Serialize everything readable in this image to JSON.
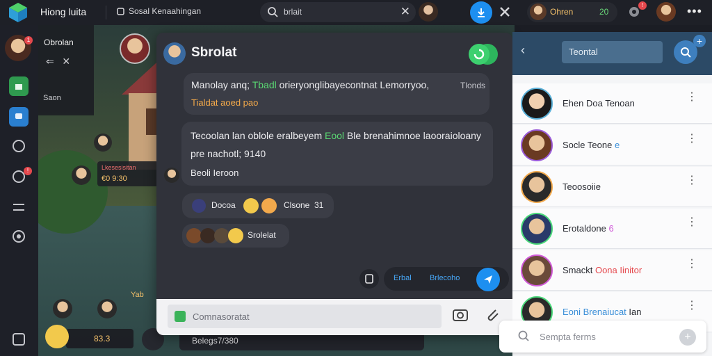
{
  "app": {
    "name": "Hiong luita",
    "workspace": "Sosal Kenaahingan"
  },
  "search": {
    "value": "brlait"
  },
  "user": {
    "name": "Ohren",
    "count": "20"
  },
  "friend_panel": {
    "name": "Obrolan",
    "status": "Saon"
  },
  "scene": {
    "tag_title": "Lkesesisitan",
    "tag_value": "€0 9:30",
    "bottom_tag": "83.3",
    "coord": "Belegs7/380",
    "note": "Yab"
  },
  "chat": {
    "title": "Sbrolat",
    "messages": [
      {
        "parts": [
          "Manolay anq; ",
          "Tbadl",
          " orieryonglibayecontnat Lemorryoo, "
        ],
        "meta": "Tlonds",
        "line2": "Tialdat aoed pao"
      },
      {
        "line1a": "Tecoolan lan oblole eralbeyem ",
        "line1b": "Eool",
        "line1c": " Ble brenahimnoe laooraioloany",
        "line2": "pre nachotl; 9140",
        "line3": "Beoli Ieroon"
      },
      {
        "left": "Docoa",
        "right": "Clsone",
        "num": "31"
      },
      {
        "text": "Srolelat"
      }
    ],
    "chip_left": "Erbal",
    "chip_right": "Brlecoho",
    "composer_placeholder": "Comnasoratat"
  },
  "right_panel": {
    "field": "Teontal",
    "contacts": [
      {
        "name": "Ehen Doa Tenoan"
      },
      {
        "name": "Socle Teone",
        "accent": "e"
      },
      {
        "name": "Teoosoiie"
      },
      {
        "name": "Erotaldone",
        "accent": "6"
      },
      {
        "name": "Smackt",
        "accent": "Oona Iinitor"
      },
      {
        "name": "Eoni Brenaiucat",
        "accent": "Ian"
      }
    ],
    "search_placeholder": "Sempta ferms"
  },
  "colors": {
    "accent": "#1d8ff0",
    "green": "#5ad873",
    "orange": "#f3a94a",
    "header_blue": "#2c4a66"
  }
}
